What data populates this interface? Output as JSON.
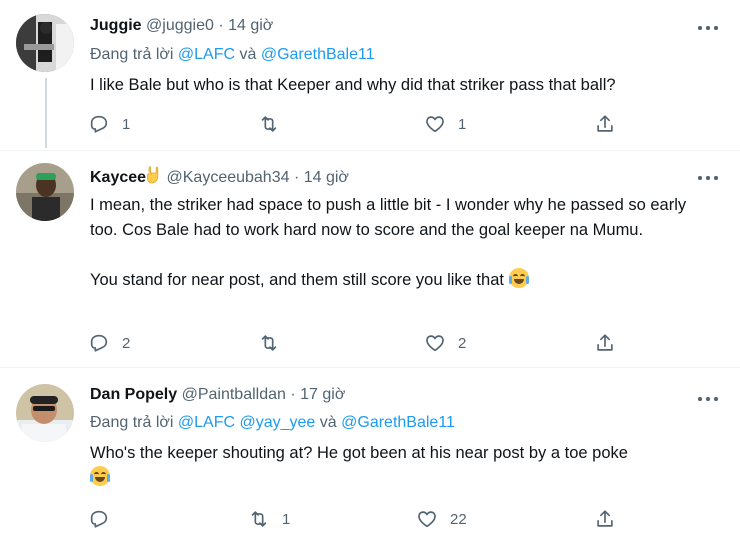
{
  "tweets": [
    {
      "name": "Juggie",
      "handle": "@juggie0",
      "dot": "·",
      "time": "14 giờ",
      "replying_prefix": "Đang trả lời",
      "replying_to": [
        "@LAFC",
        "@GarethBale11"
      ],
      "replying_and": "và",
      "text": "I like Bale but who is that Keeper and why did that striker pass that ball?",
      "replies": "1",
      "retweets": "",
      "likes": "1"
    },
    {
      "name": "Kaycee",
      "handle": "@Kayceeubah34",
      "dot": "·",
      "time": "14 giờ",
      "text_para1": "I mean, the striker had space to push a little bit - I wonder why he passed so early too. Cos Bale had to work hard now to score and the goal keeper na Mumu.",
      "text_para2": "You stand for near post, and them still score you like that",
      "replies": "2",
      "retweets": "",
      "likes": "2"
    },
    {
      "name": "Dan Popely",
      "handle": "@Paintballdan",
      "dot": "·",
      "time": "17 giờ",
      "replying_prefix": "Đang trả lời",
      "replying_to": [
        "@LAFC",
        "@yay_yee",
        "@GarethBale11"
      ],
      "replying_and": "và",
      "text": "Who's the keeper shouting at? He got been at his near post by a toe poke",
      "replies": "",
      "retweets": "1",
      "likes": "22"
    }
  ],
  "icons": {
    "reply": "reply-icon",
    "retweet": "retweet-icon",
    "like": "heart-icon",
    "share": "share-icon",
    "more": "more-icon",
    "emoji": "tears-of-joy-emoji",
    "hand": "rock-hand-emoji"
  },
  "colors": {
    "link": "#1d9bf0",
    "muted": "#536471",
    "text": "#0f1419"
  }
}
